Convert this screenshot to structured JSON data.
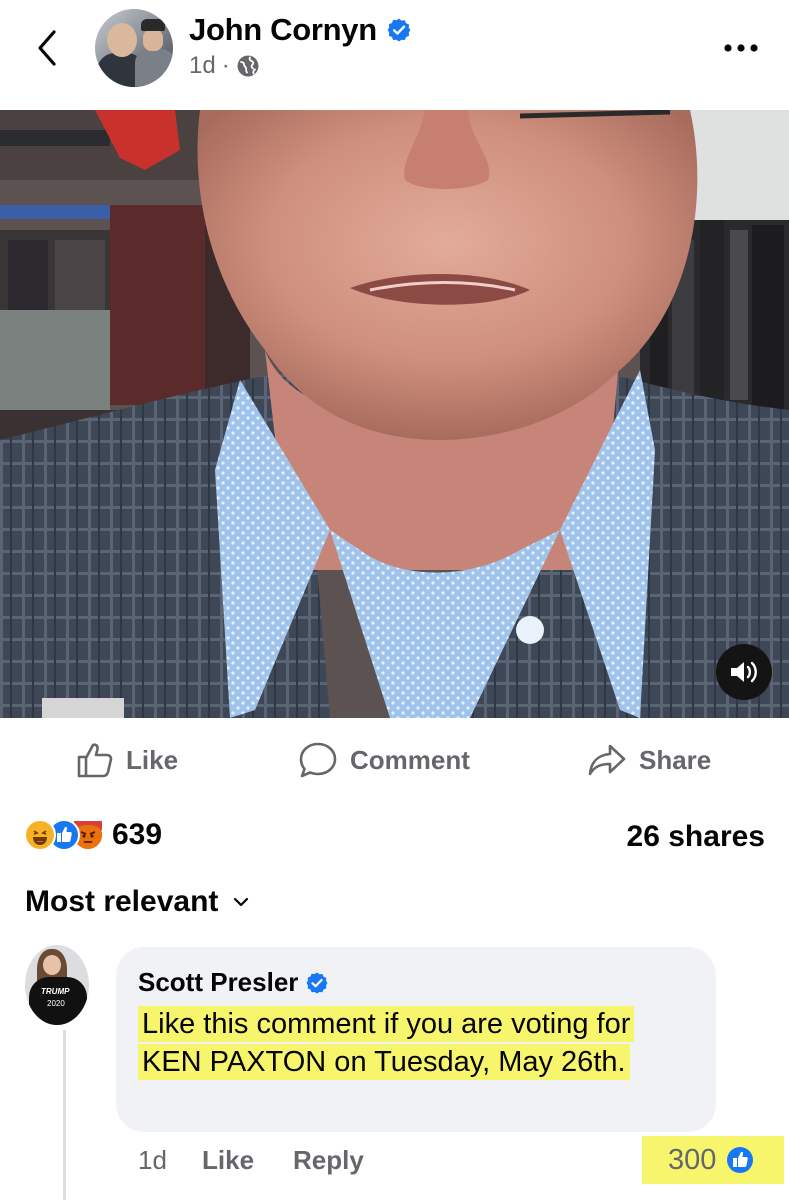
{
  "header": {
    "page_name": "John Cornyn",
    "timestamp": "1d",
    "separator": "·",
    "privacy_icon": "globe-icon",
    "back_icon": "chevron-left-icon",
    "more_icon": "more-dots-icon"
  },
  "video": {
    "sound_icon": "speaker-icon"
  },
  "actions": {
    "like_label": "Like",
    "comment_label": "Comment",
    "share_label": "Share"
  },
  "engagement": {
    "reaction_icons": [
      "haha-reaction-icon",
      "like-reaction-icon",
      "angry-reaction-icon"
    ],
    "reaction_count": "639",
    "shares": "26 shares"
  },
  "comments": {
    "sort_label": "Most relevant",
    "items": [
      {
        "author": "Scott Presler",
        "verified": true,
        "avatar_shirt_text": "TRUMP",
        "avatar_shirt_text_2": "2020",
        "text": "Like this comment if you are voting for KEN PAXTON on Tuesday, May 26th.",
        "time": "1d",
        "like_label": "Like",
        "reply_label": "Reply",
        "like_count": "300"
      }
    ]
  },
  "colors": {
    "brand_blue": "#1877F2",
    "secondary_text": "#65676B",
    "highlight": "#F6F56C",
    "bubble_bg": "#F0F2F5"
  }
}
